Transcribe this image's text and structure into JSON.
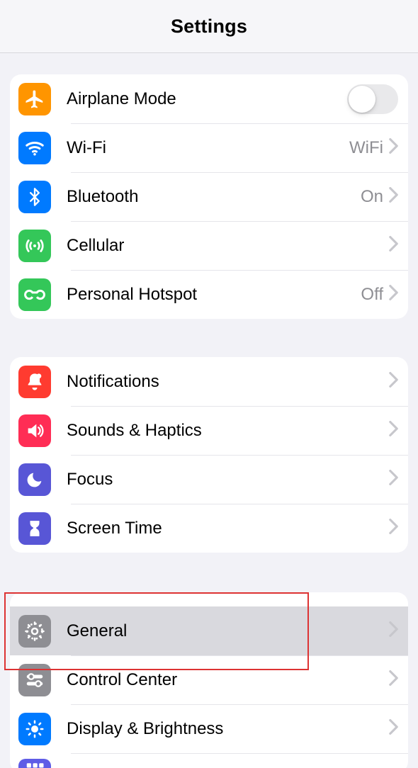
{
  "header": {
    "title": "Settings"
  },
  "group1": {
    "airplane": {
      "label": "Airplane Mode",
      "on": false
    },
    "wifi": {
      "label": "Wi-Fi",
      "value": "WiFi"
    },
    "bluetooth": {
      "label": "Bluetooth",
      "value": "On"
    },
    "cellular": {
      "label": "Cellular"
    },
    "hotspot": {
      "label": "Personal Hotspot",
      "value": "Off"
    }
  },
  "group2": {
    "notifications": {
      "label": "Notifications"
    },
    "sounds": {
      "label": "Sounds & Haptics"
    },
    "focus": {
      "label": "Focus"
    },
    "screentime": {
      "label": "Screen Time"
    }
  },
  "group3": {
    "general": {
      "label": "General"
    },
    "control": {
      "label": "Control Center"
    },
    "display": {
      "label": "Display & Brightness"
    }
  },
  "annotation": {
    "highlighted_row": "general"
  }
}
